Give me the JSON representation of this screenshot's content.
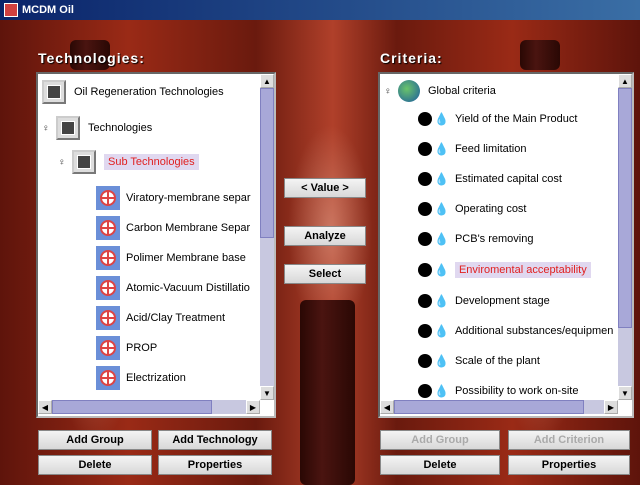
{
  "window": {
    "title": "MCDM Oil"
  },
  "technologies": {
    "header": "Technologies:",
    "root": "Oil Regeneration Technologies",
    "group": "Technologies",
    "subgroup": "Sub Technologies",
    "items": [
      "Viratory-membrane separ",
      "Carbon Membrane Separ",
      "Polimer Membrane base",
      "Atomic-Vacuum Distillatio",
      "Acid/Clay Treatment",
      "PROP",
      "Electrization"
    ]
  },
  "criteria": {
    "header": "Criteria:",
    "root": "Global criteria",
    "selected_index": 5,
    "items": [
      "Yield of the Main Product",
      "Feed limitation",
      "Estimated capital cost",
      "Operating cost",
      "PCB's removing",
      "Enviromental acceptability",
      "Development stage",
      "Additional substances/equipmen",
      "Scale of the plant",
      "Possibility to work on-site"
    ]
  },
  "middle": {
    "value_button": "< Value >",
    "analyze_button": "Analyze",
    "select_button": "Select"
  },
  "left_buttons": {
    "add_group": "Add Group",
    "add_technology": "Add Technology",
    "delete": "Delete",
    "properties": "Properties"
  },
  "right_buttons": {
    "add_group": "Add Group",
    "add_criterion": "Add Criterion",
    "delete": "Delete",
    "properties": "Properties"
  }
}
